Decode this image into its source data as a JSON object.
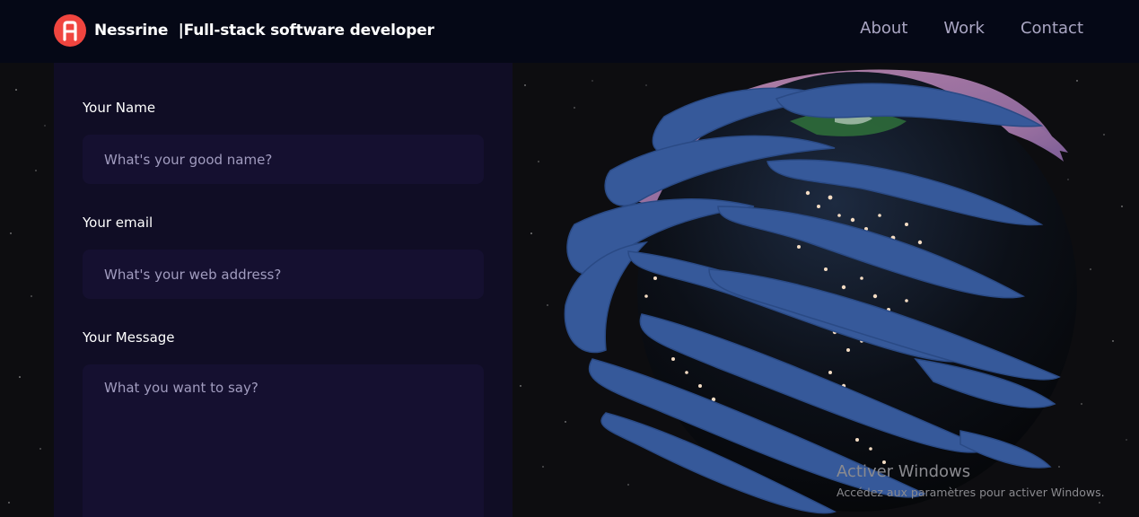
{
  "navbar": {
    "brand_name": "Nessrine  |Full-stack software developer",
    "links": [
      {
        "label": "About"
      },
      {
        "label": "Work"
      },
      {
        "label": "Contact"
      }
    ]
  },
  "contact_form": {
    "name_label": "Your Name",
    "name_placeholder": "What's your good name?",
    "email_label": "Your email",
    "email_placeholder": "What's your web address?",
    "message_label": "Your Message",
    "message_placeholder": "What you want to say?"
  },
  "watermark": {
    "title": "Activer Windows",
    "subtitle": "Accédez aux paramètres pour activer Windows."
  },
  "colors": {
    "nav_bg": "#050816",
    "panel_bg": "#100d25",
    "input_bg": "#151030",
    "logo_red": "#f0453f",
    "nav_link": "#aaa6c3"
  },
  "icons": {
    "logo": "brand-logo-icon"
  }
}
